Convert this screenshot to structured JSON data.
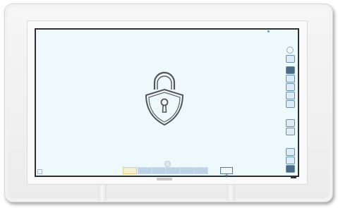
{
  "scene": {
    "locked_icon": "padlock-icon",
    "screen_color": "#edf9fa",
    "accent_color": "#39a6e8"
  },
  "side_toolbar": {
    "buttons": [
      {
        "icon": "settings-circle-icon"
      },
      {
        "icon": "menu-icon"
      },
      {
        "icon": "pen-icon"
      },
      {
        "icon": "eraser-icon"
      },
      {
        "icon": "select-icon"
      },
      {
        "icon": "zoom-icon"
      },
      {
        "icon": "undo-icon"
      },
      {
        "icon": "redo-icon"
      },
      {
        "icon": "share-icon"
      },
      {
        "icon": "save-icon"
      },
      {
        "icon": "power-icon"
      }
    ]
  },
  "bottom_bar": {
    "pages": [
      "page-1",
      "page-2",
      "page-3",
      "page-4",
      "page-5",
      "page-6",
      "page-7"
    ],
    "active_page_index": 0,
    "add_page_icon": "plus-icon"
  }
}
